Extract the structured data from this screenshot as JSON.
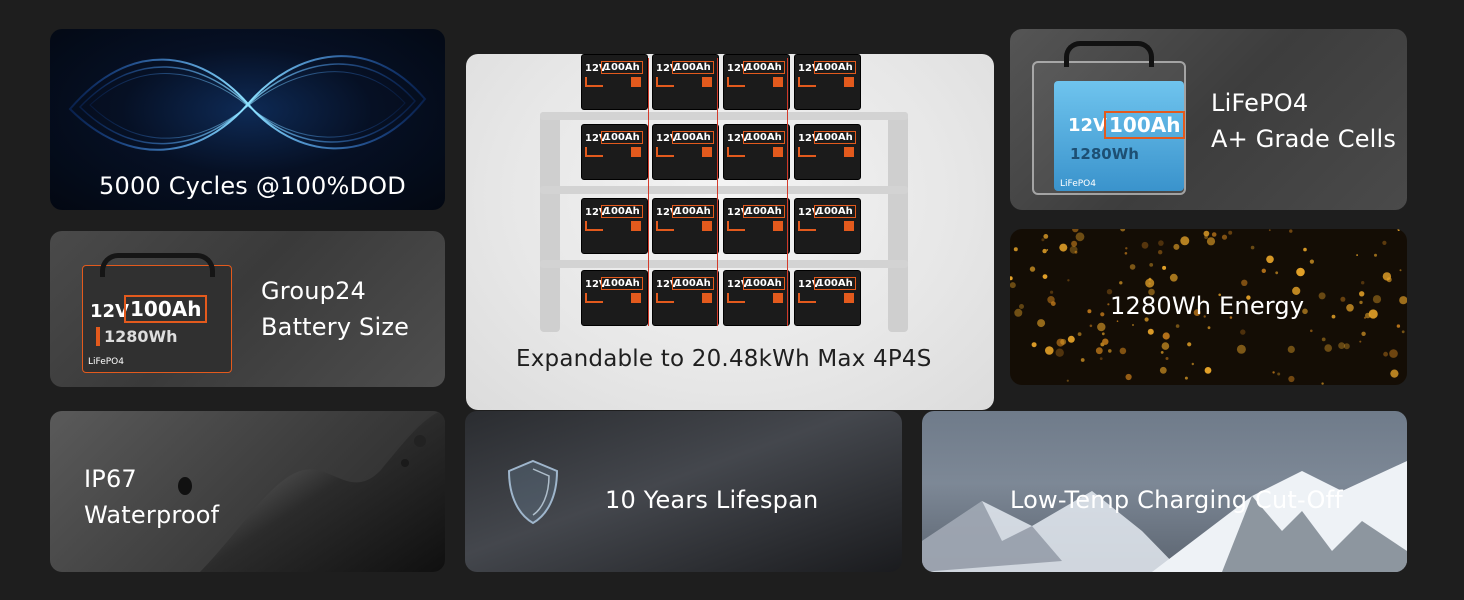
{
  "features": {
    "cycles": {
      "text": "5000 Cycles @100%DOD"
    },
    "group24": {
      "line1": "Group24",
      "line2": "Battery Size"
    },
    "expandable": {
      "text": "Expandable to 20.48kWh Max 4P4S"
    },
    "cells": {
      "line1": "LiFePO4",
      "line2": "A+ Grade Cells"
    },
    "energy": {
      "text": "1280Wh Energy"
    },
    "waterproof": {
      "line1": "IP67",
      "line2": "Waterproof"
    },
    "lifespan": {
      "text": "10 Years Lifespan"
    },
    "lowtemp": {
      "text": "Low-Temp Charging Cut-Off"
    }
  },
  "battery": {
    "voltage": "12V",
    "capacity": "100Ah",
    "energy": "1280Wh",
    "chemistry": "LiFePO4"
  },
  "colors": {
    "background": "#1e1e1e",
    "accent": "#e35a1d",
    "text": "#ffffff"
  }
}
